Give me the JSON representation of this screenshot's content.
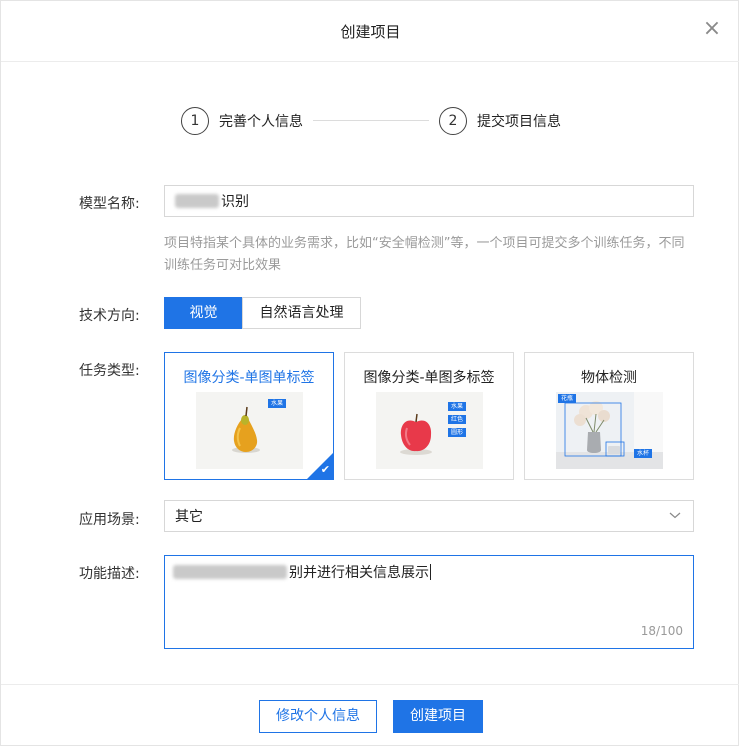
{
  "dialog": {
    "title": "创建项目",
    "close_glyph": "×"
  },
  "steps": [
    {
      "number": "1",
      "label": "完善个人信息"
    },
    {
      "number": "2",
      "label": "提交项目信息"
    }
  ],
  "form": {
    "model_name": {
      "label": "模型名称:",
      "value_visible": "识别",
      "hint": "项目特指某个具体的业务需求，比如“安全帽检测”等，一个项目可提交多个训练任务，不同训练任务可对比效果"
    },
    "tech_direction": {
      "label": "技术方向:",
      "options": [
        "视觉",
        "自然语言处理"
      ],
      "selected": "视觉"
    },
    "task_type": {
      "label": "任务类型:",
      "cards": [
        {
          "title": "图像分类-单图单标签",
          "tags": [
            "水果"
          ],
          "selected": true
        },
        {
          "title": "图像分类-单图多标签",
          "tags": [
            "水果",
            "红色",
            "圆形"
          ],
          "selected": false
        },
        {
          "title": "物体检测",
          "tags": [
            "花瓶",
            "水杯"
          ],
          "selected": false
        }
      ]
    },
    "scenario": {
      "label": "应用场景:",
      "value": "其它"
    },
    "description": {
      "label": "功能描述:",
      "value_visible": "别并进行相关信息展示",
      "counter": "18/100"
    }
  },
  "footer": {
    "back_label": "修改个人信息",
    "submit_label": "创建项目"
  },
  "colors": {
    "accent": "#1f74e6",
    "border": "#d7d7d7",
    "hint": "#9a9a9a"
  },
  "icons": {
    "close": "close-icon",
    "dropdown": "chevron-down-icon",
    "check": "checkmark-icon"
  }
}
